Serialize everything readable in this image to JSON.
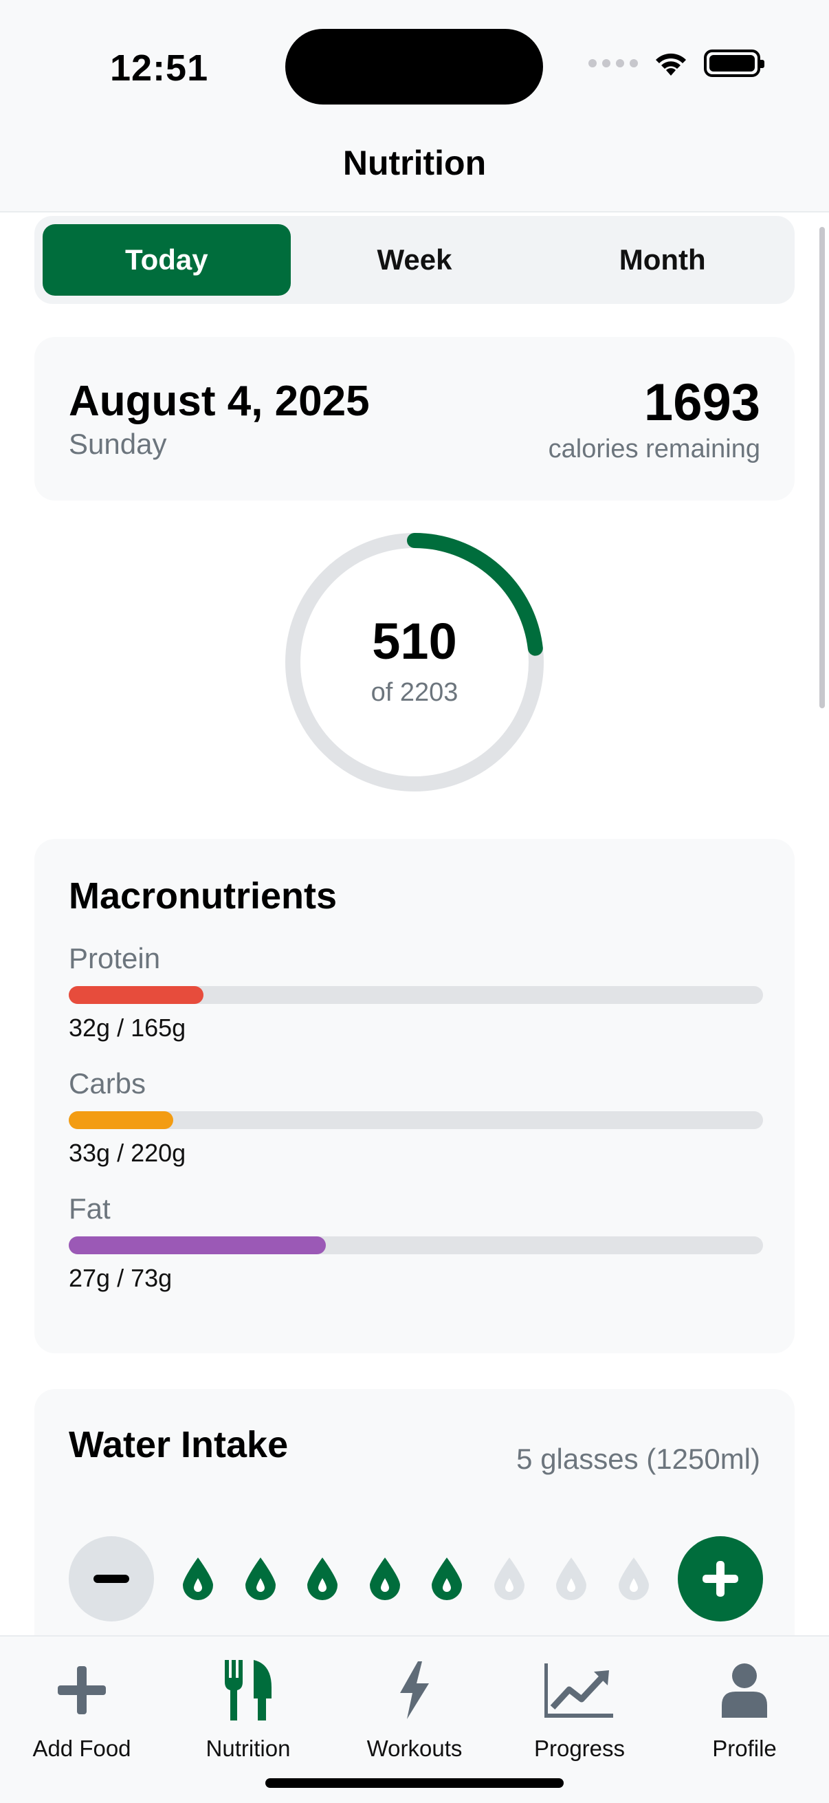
{
  "status_bar": {
    "time": "12:51"
  },
  "header": {
    "title": "Nutrition"
  },
  "segments": [
    {
      "label": "Today",
      "active": true
    },
    {
      "label": "Week",
      "active": false
    },
    {
      "label": "Month",
      "active": false
    }
  ],
  "date_card": {
    "date": "August 4, 2025",
    "weekday": "Sunday",
    "calories_remaining": "1693",
    "calories_remaining_label": "calories remaining"
  },
  "calorie_ring": {
    "consumed": "510",
    "goal_label": "of 2203",
    "consumed_value": 510,
    "goal_value": 2203,
    "progress_color": "#006d3c",
    "track_color": "#e1e3e6"
  },
  "macros": {
    "title": "Macronutrients",
    "items": [
      {
        "name": "Protein",
        "value": "32g / 165g",
        "fraction": 0.194,
        "color": "#e74c3c"
      },
      {
        "name": "Carbs",
        "value": "33g / 220g",
        "fraction": 0.15,
        "color": "#f39c12"
      },
      {
        "name": "Fat",
        "value": "27g / 73g",
        "fraction": 0.37,
        "color": "#9b59b6"
      }
    ]
  },
  "water": {
    "title": "Water Intake",
    "amount": "5 glasses (1250ml)",
    "glasses_filled": 5,
    "glasses_total": 8,
    "filled_color": "#006d3c",
    "empty_color": "#dee2e6"
  },
  "tabbar": {
    "items": [
      {
        "label": "Add Food",
        "icon": "plus-icon",
        "active": false
      },
      {
        "label": "Nutrition",
        "icon": "fork-knife-icon",
        "active": true
      },
      {
        "label": "Workouts",
        "icon": "lightning-icon",
        "active": false
      },
      {
        "label": "Progress",
        "icon": "chart-line-icon",
        "active": false
      },
      {
        "label": "Profile",
        "icon": "person-icon",
        "active": false
      }
    ],
    "active_color": "#006d3c",
    "inactive_color": "#5f6b77"
  }
}
